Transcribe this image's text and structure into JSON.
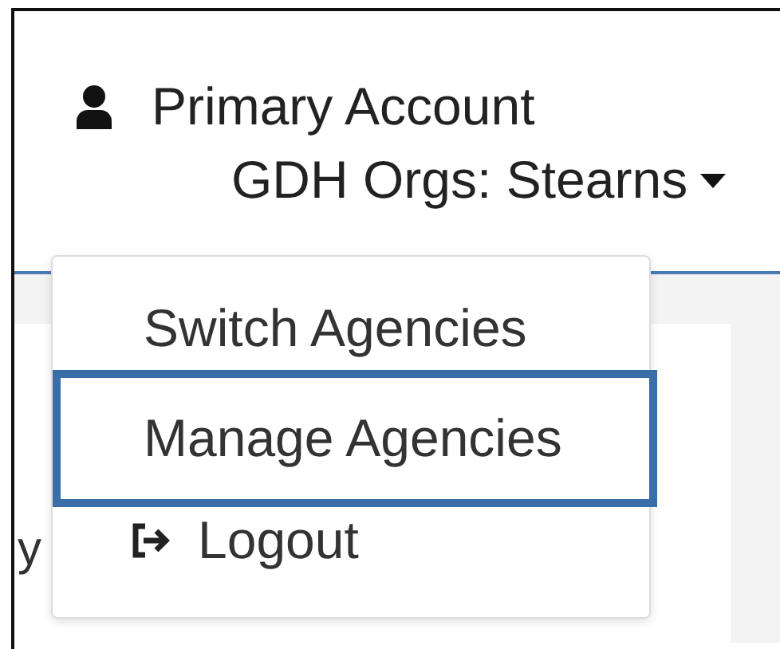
{
  "account": {
    "label": "Primary Account",
    "org": "GDH Orgs: Stearns"
  },
  "background_text": "y",
  "menu": [
    {
      "label": "Switch Agencies",
      "kind": "plain",
      "selected": false
    },
    {
      "label": "Manage Agencies",
      "kind": "plain",
      "selected": true
    },
    {
      "label": "Logout",
      "kind": "logout",
      "selected": false
    }
  ]
}
